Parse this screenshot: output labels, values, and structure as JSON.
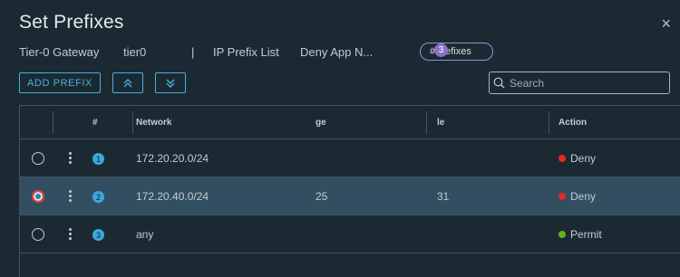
{
  "dialog": {
    "title": "Set Prefixes",
    "close_symbol": "×"
  },
  "meta": {
    "gateway_label": "Tier-0 Gateway",
    "gateway_value": "tier0",
    "separator": "|",
    "prefix_list_label": "IP Prefix List",
    "prefix_list_value": "Deny App N...",
    "chip_label": "#Prefixes",
    "chip_count": "3"
  },
  "toolbar": {
    "add_label": "ADD PREFIX",
    "move_up_icon": "double-chevron-up-icon",
    "move_down_icon": "double-chevron-down-icon"
  },
  "search": {
    "placeholder": "Search",
    "value": ""
  },
  "table": {
    "headers": {
      "index": "#",
      "network": "Network",
      "ge": "ge",
      "le": "le",
      "action": "Action"
    },
    "rows": [
      {
        "index": "1",
        "network": "172.20.20.0/24",
        "ge": "",
        "le": "",
        "action": "Deny",
        "selected": false
      },
      {
        "index": "2",
        "network": "172.20.40.0/24",
        "ge": "25",
        "le": "31",
        "action": "Deny",
        "selected": true
      },
      {
        "index": "3",
        "network": "any",
        "ge": "",
        "le": "",
        "action": "Permit",
        "selected": false
      }
    ]
  },
  "colors": {
    "accent": "#49afd9",
    "deny": "#e12b21",
    "permit": "#5eb715",
    "chip_border": "#9b8ad6",
    "selected_row": "#324f61",
    "background": "#1b2a32"
  }
}
